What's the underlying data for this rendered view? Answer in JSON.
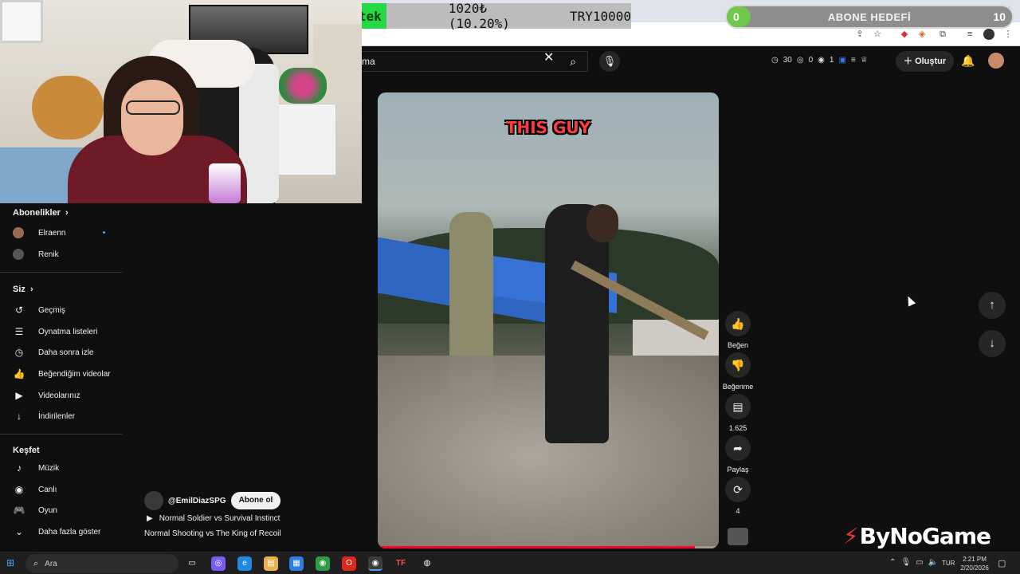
{
  "overlay": {
    "donation_label": "Destek",
    "donation_amount": "1020₺ (10.20%)",
    "donation_goal": "TRY10000",
    "sub_goal_start": "0",
    "sub_goal_title": "ABONE HEDEFİ",
    "sub_goal_end": "10",
    "sub_goal_progress": 0
  },
  "header": {
    "search_value": "ma",
    "stats": [
      "30",
      "0",
      "1"
    ],
    "create_label": "Oluştur"
  },
  "sidebar": {
    "subscriptions_title": "Abonelikler",
    "subscriptions": [
      {
        "label": "Elraenn",
        "has_new": true
      },
      {
        "label": "Renik",
        "has_new": false
      }
    ],
    "you_title": "Siz",
    "you_items": [
      {
        "label": "Geçmiş",
        "icon": "history-icon"
      },
      {
        "label": "Oynatma listeleri",
        "icon": "playlists-icon"
      },
      {
        "label": "Daha sonra izle",
        "icon": "watch-later-icon"
      },
      {
        "label": "Beğendiğim videolar",
        "icon": "thumbs-up-icon"
      },
      {
        "label": "Videolarınız",
        "icon": "your-videos-icon"
      },
      {
        "label": "İndirilenler",
        "icon": "download-icon"
      }
    ],
    "explore_title": "Keşfet",
    "explore_items": [
      {
        "label": "Müzik",
        "icon": "music-icon"
      },
      {
        "label": "Canlı",
        "icon": "live-icon"
      },
      {
        "label": "Oyun",
        "icon": "gaming-icon"
      },
      {
        "label": "Daha fazla göster",
        "icon": "chevron-down-icon"
      }
    ]
  },
  "video": {
    "caption": "THIS GUY",
    "progress": 0.93,
    "channel_name": "@EmilDiazSPG",
    "subscribe_label": "Abone ol",
    "playlist_title": "Normal Soldier vs Survival Instinct",
    "description": "Normal Shooting vs The King of Recoil"
  },
  "actions": {
    "like_label": "Beğen",
    "dislike_label": "Beğenme",
    "comments_count": "1.625",
    "share_label": "Paylaş",
    "remix_count": "4"
  },
  "watermark": "ByNoGame",
  "taskbar": {
    "search_placeholder": "Ara",
    "language": "TUR",
    "time": "2:21 PM",
    "date": "2/20/2026"
  },
  "colors": {
    "accent_red": "#ff0033",
    "donation_green": "#27d845",
    "sub_goal_green": "#6fc84a"
  }
}
